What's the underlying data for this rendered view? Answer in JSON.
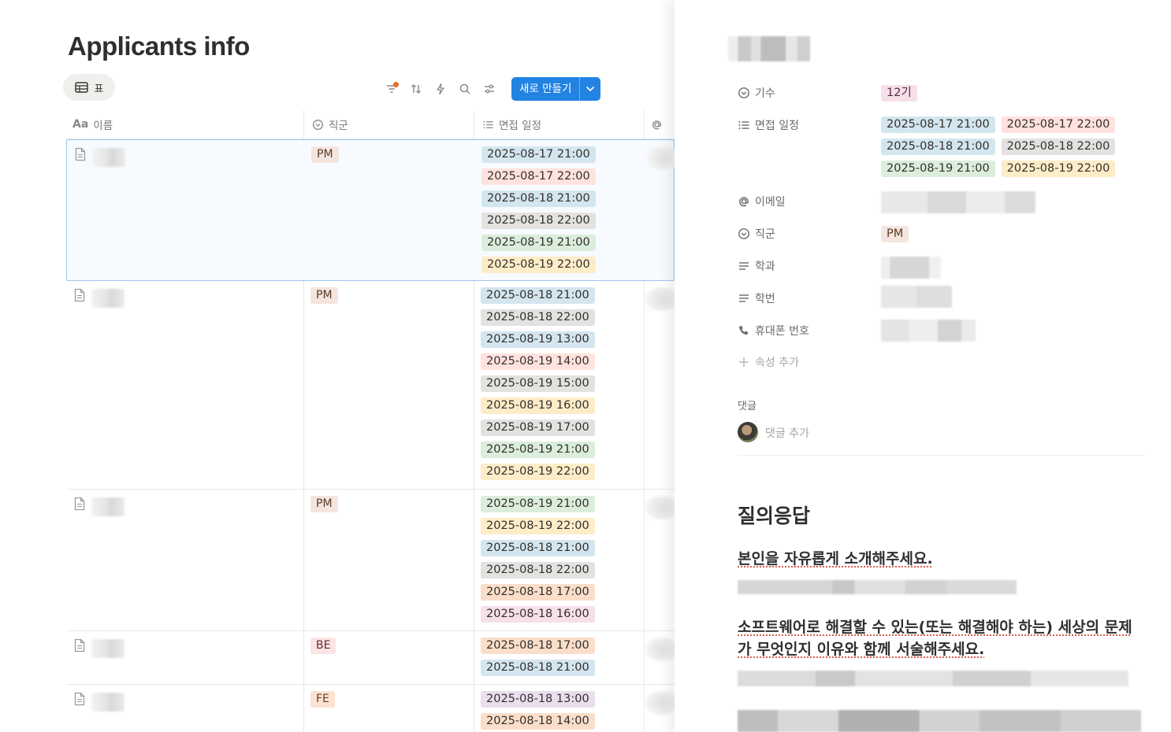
{
  "table": {
    "title": "Applicants info",
    "view_tab_label": "표",
    "new_button_label": "새로 만들기",
    "columns": {
      "name": "이름",
      "name_icon": "Aa",
      "role": "직군",
      "schedule": "면접 일정"
    },
    "rows": [
      {
        "role": "PM",
        "role_color": "pm",
        "dates": [
          {
            "text": "2025-08-17 21:00",
            "color": "blue"
          },
          {
            "text": "2025-08-17 22:00",
            "color": "red"
          },
          {
            "text": "2025-08-18 21:00",
            "color": "blue"
          },
          {
            "text": "2025-08-18 22:00",
            "color": "gray"
          },
          {
            "text": "2025-08-19 21:00",
            "color": "green"
          },
          {
            "text": "2025-08-19 22:00",
            "color": "yellow"
          }
        ]
      },
      {
        "role": "PM",
        "role_color": "pm",
        "dates": [
          {
            "text": "2025-08-18 21:00",
            "color": "blue"
          },
          {
            "text": "2025-08-18 22:00",
            "color": "gray"
          },
          {
            "text": "2025-08-19 13:00",
            "color": "blue"
          },
          {
            "text": "2025-08-19 14:00",
            "color": "red"
          },
          {
            "text": "2025-08-19 15:00",
            "color": "gray"
          },
          {
            "text": "2025-08-19 16:00",
            "color": "yellow"
          },
          {
            "text": "2025-08-19 17:00",
            "color": "gray"
          },
          {
            "text": "2025-08-19 21:00",
            "color": "green"
          },
          {
            "text": "2025-08-19 22:00",
            "color": "yellow"
          }
        ]
      },
      {
        "role": "PM",
        "role_color": "pm",
        "dates": [
          {
            "text": "2025-08-19 21:00",
            "color": "green"
          },
          {
            "text": "2025-08-19 22:00",
            "color": "yellow"
          },
          {
            "text": "2025-08-18 21:00",
            "color": "blue"
          },
          {
            "text": "2025-08-18 22:00",
            "color": "gray"
          },
          {
            "text": "2025-08-18 17:00",
            "color": "orange"
          },
          {
            "text": "2025-08-18 16:00",
            "color": "pink"
          }
        ]
      },
      {
        "role": "BE",
        "role_color": "be",
        "dates": [
          {
            "text": "2025-08-18 17:00",
            "color": "orange"
          },
          {
            "text": "2025-08-18 21:00",
            "color": "blue"
          }
        ]
      },
      {
        "role": "FE",
        "role_color": "fe",
        "dates": [
          {
            "text": "2025-08-18 13:00",
            "color": "purple"
          },
          {
            "text": "2025-08-18 14:00",
            "color": "orange"
          }
        ]
      }
    ]
  },
  "peek": {
    "props": {
      "cohort_label": "기수",
      "cohort_value": "12기",
      "schedule_label": "면접 일정",
      "schedule_values": [
        {
          "text": "2025-08-17 21:00",
          "color": "blue"
        },
        {
          "text": "2025-08-17 22:00",
          "color": "red"
        },
        {
          "text": "2025-08-18 21:00",
          "color": "blue"
        },
        {
          "text": "2025-08-18 22:00",
          "color": "gray"
        },
        {
          "text": "2025-08-19 21:00",
          "color": "green"
        },
        {
          "text": "2025-08-19 22:00",
          "color": "yellow"
        }
      ],
      "email_label": "이메일",
      "role_label": "직군",
      "role_value": "PM",
      "major_label": "학과",
      "student_id_label": "학번",
      "phone_label": "휴대폰 번호"
    },
    "add_property_label": "속성 추가",
    "comments_label": "댓글",
    "comment_placeholder": "댓글 추가",
    "qa_heading": "질의응답",
    "questions": [
      "본인을 자유롭게 소개해주세요.",
      "소프트웨어로 해결할 수 있는(또는 해결해야 하는) 세상의 문제가 무엇인지 이유와 함께 서술해주세요."
    ]
  },
  "colors": {
    "accent": "#2383e2",
    "blue": "#d3e5ef",
    "red": "#ffe2dd",
    "gray": "#e3e2e0",
    "green": "#dbeddb",
    "yellow": "#fdecc8",
    "orange": "#fadec9",
    "pink": "#f5e0e9",
    "purple": "#e8deee"
  }
}
